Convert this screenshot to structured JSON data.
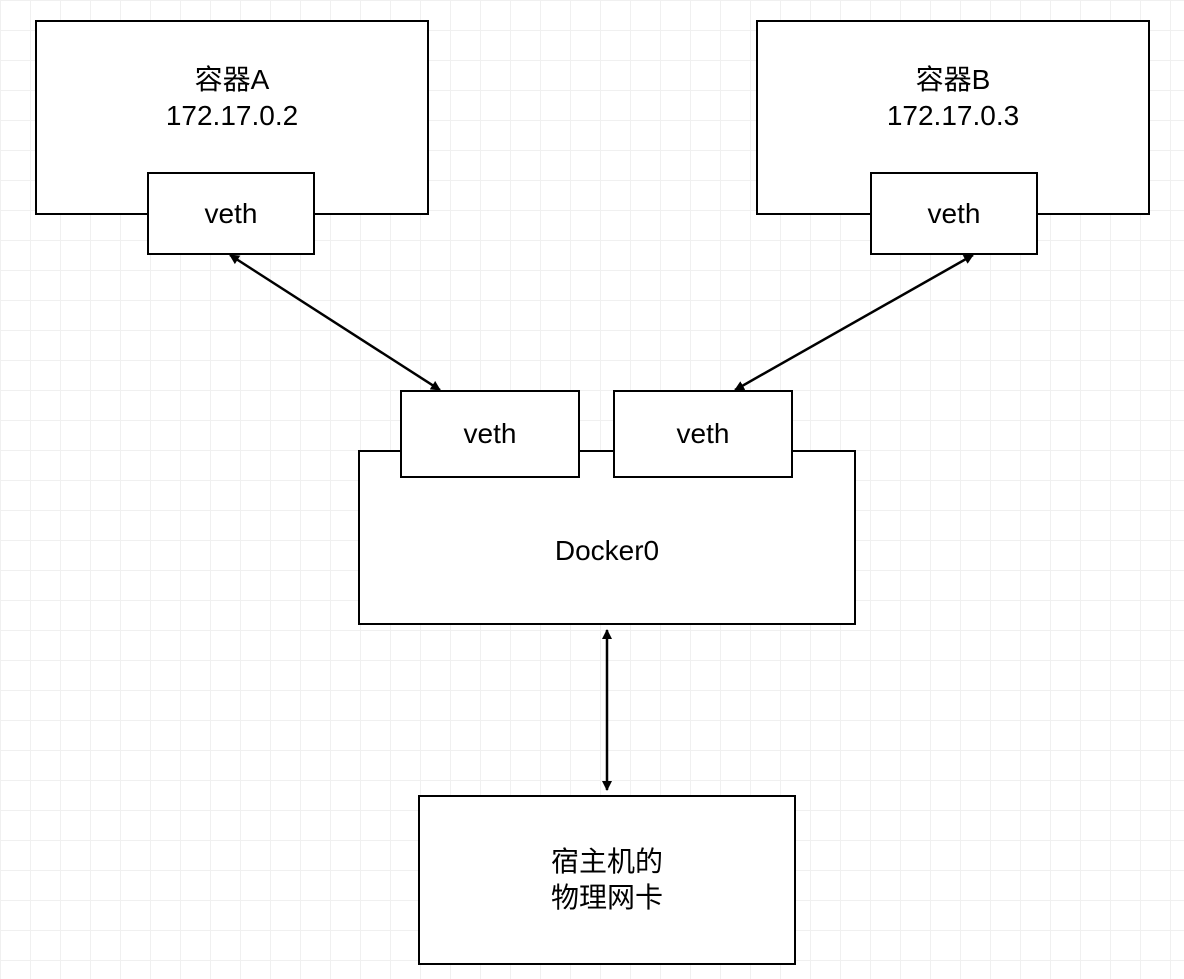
{
  "containerA": {
    "title": "容器A",
    "ip": "172.17.0.2",
    "veth_label": "veth"
  },
  "containerB": {
    "title": "容器B",
    "ip": "172.17.0.3",
    "veth_label": "veth"
  },
  "bridge": {
    "veth_left_label": "veth",
    "veth_right_label": "veth",
    "name": "Docker0"
  },
  "host_nic": {
    "line1": "宿主机的",
    "line2": "物理网卡"
  }
}
